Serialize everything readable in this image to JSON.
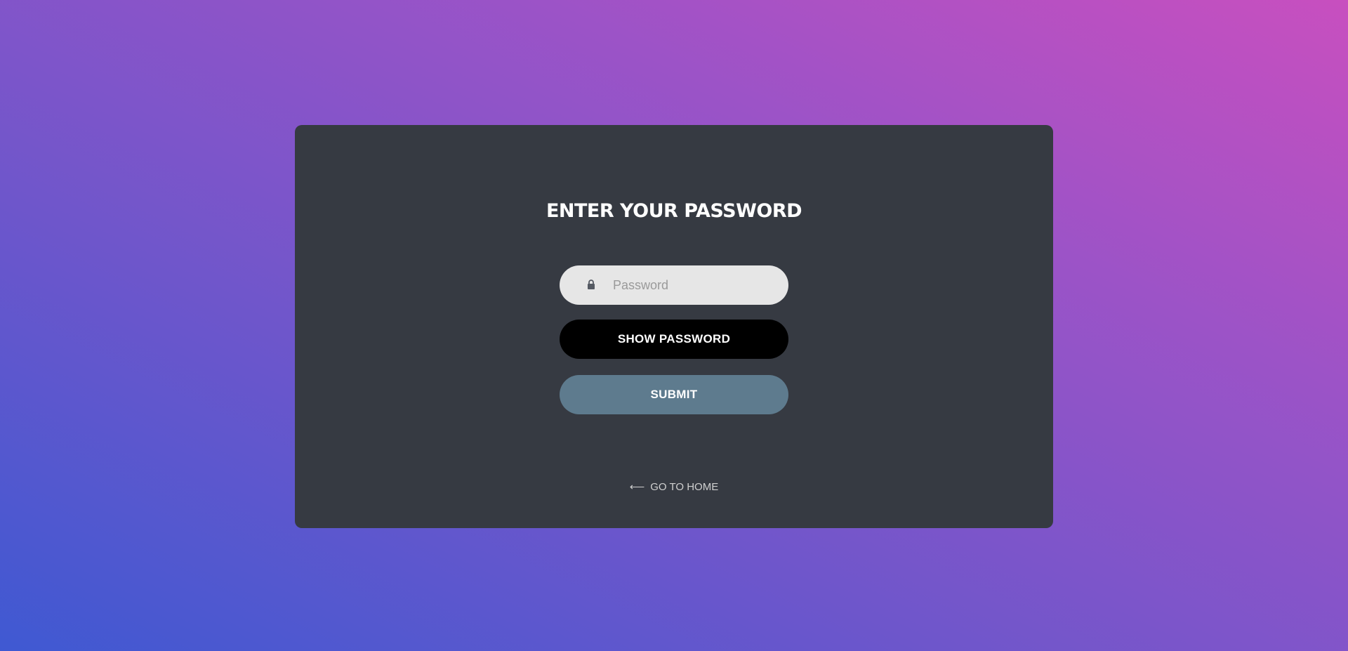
{
  "login": {
    "title": "ENTER YOUR PASSWORD",
    "password": {
      "placeholder": "Password",
      "value": "",
      "icon": "lock-icon"
    },
    "show_password_label": "SHOW PASSWORD",
    "submit_label": "SUBMIT",
    "home_link": {
      "icon": "arrow-left-icon",
      "label": "GO TO HOME"
    }
  },
  "colors": {
    "card_background": "#363a42",
    "input_background": "#e6e6e6",
    "show_button": "#000000",
    "submit_button": "#5e7b8e",
    "gradient_start": "#3f59d2",
    "gradient_end": "#c84fbf"
  }
}
